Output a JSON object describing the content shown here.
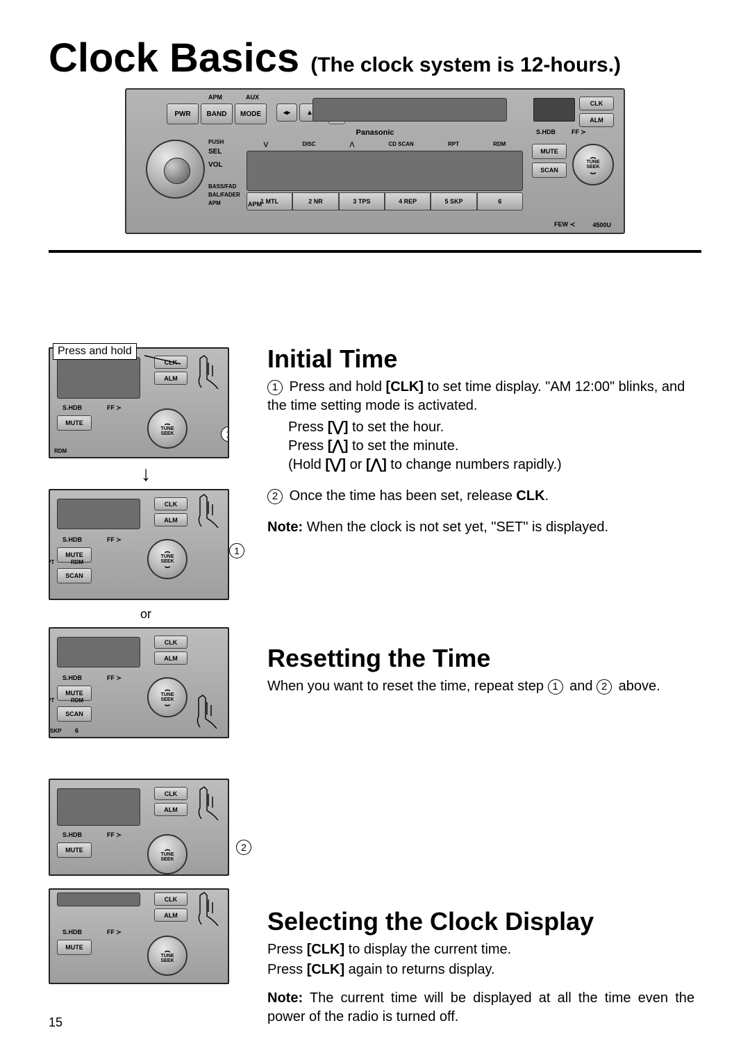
{
  "title_main": "Clock Basics",
  "title_sub": "(The clock system is 12-hours.)",
  "radio": {
    "top_labels": {
      "apm": "APM",
      "aux": "AUX"
    },
    "buttons": {
      "pwr": "PWR",
      "band": "BAND",
      "mode": "MODE",
      "eject": "▲"
    },
    "nav": "◂▸",
    "brand": "Panasonic",
    "shdb": "S.HDB",
    "ff": "FF ≻",
    "side": {
      "clk": "CLK",
      "alm": "ALM"
    },
    "knob": {
      "push": "PUSH",
      "sel": "SEL",
      "vol": "VOL",
      "bassfad": "BASS/FAD",
      "balfader": "BAL/FADER",
      "apm": "APM"
    },
    "disc_row": {
      "down": "⋁",
      "disc": "DISC",
      "up": "⋀",
      "cdscan": "CD SCAN",
      "rpt": "RPT",
      "rdm": "RDM"
    },
    "presets": [
      "1 MTL",
      "2 NR",
      "3 TPS",
      "4 REP",
      "5 SKP",
      "6"
    ],
    "right": {
      "mute": "MUTE",
      "scan": "SCAN"
    },
    "tune": {
      "tune": "TUNE",
      "seek": "SEEK"
    },
    "bottom": {
      "apm": "APM",
      "few": "FEW ≺",
      "model": "4500U"
    }
  },
  "mini": {
    "press_hold": "Press and hold",
    "clk": "CLK",
    "alm": "ALM",
    "shdb": "S.HDB",
    "ff": "FF ≻",
    "mute": "MUTE",
    "scan": "SCAN",
    "tune": "TUNE",
    "seek": "SEEK",
    "rdm": "RDM",
    "pt": "PT",
    "skp": "SKP",
    "six": "6",
    "or": "or"
  },
  "callouts": {
    "one": "1",
    "two": "2"
  },
  "sections": {
    "initial": {
      "heading": "Initial Time",
      "step1_a": "Press and hold ",
      "step1_b": "[CLK]",
      "step1_c": " to set time display. \"AM 12:00\" blinks, and the time setting mode is activated.",
      "hour_a": "Press ",
      "hour_b": "[⋁]",
      "hour_c": " to set the hour.",
      "min_a": "Press ",
      "min_b": "[⋀]",
      "min_c": " to set the minute.",
      "hold_a": "(Hold ",
      "hold_b": "[⋁]",
      "hold_c": " or ",
      "hold_d": "[⋀]",
      "hold_e": " to change numbers rapidly.)",
      "step2_a": "Once the time has been set, release ",
      "step2_b": "CLK",
      "step2_c": ".",
      "note_lead": "Note:",
      "note_body": " When the clock is not set yet, \"SET\" is displayed."
    },
    "reset": {
      "heading": "Resetting the Time",
      "body_a": "When you want to reset the time, repeat step ",
      "body_b": " and ",
      "body_c": " above."
    },
    "select": {
      "heading": "Selecting the Clock Display",
      "l1_a": "Press ",
      "l1_b": "[CLK]",
      "l1_c": " to display the current time.",
      "l2_a": "Press ",
      "l2_b": "[CLK]",
      "l2_c": " again to returns display.",
      "note_lead": "Note:",
      "note_body": " The current time will be displayed at all the time even the power of the radio is turned off."
    }
  },
  "page_number": "15"
}
